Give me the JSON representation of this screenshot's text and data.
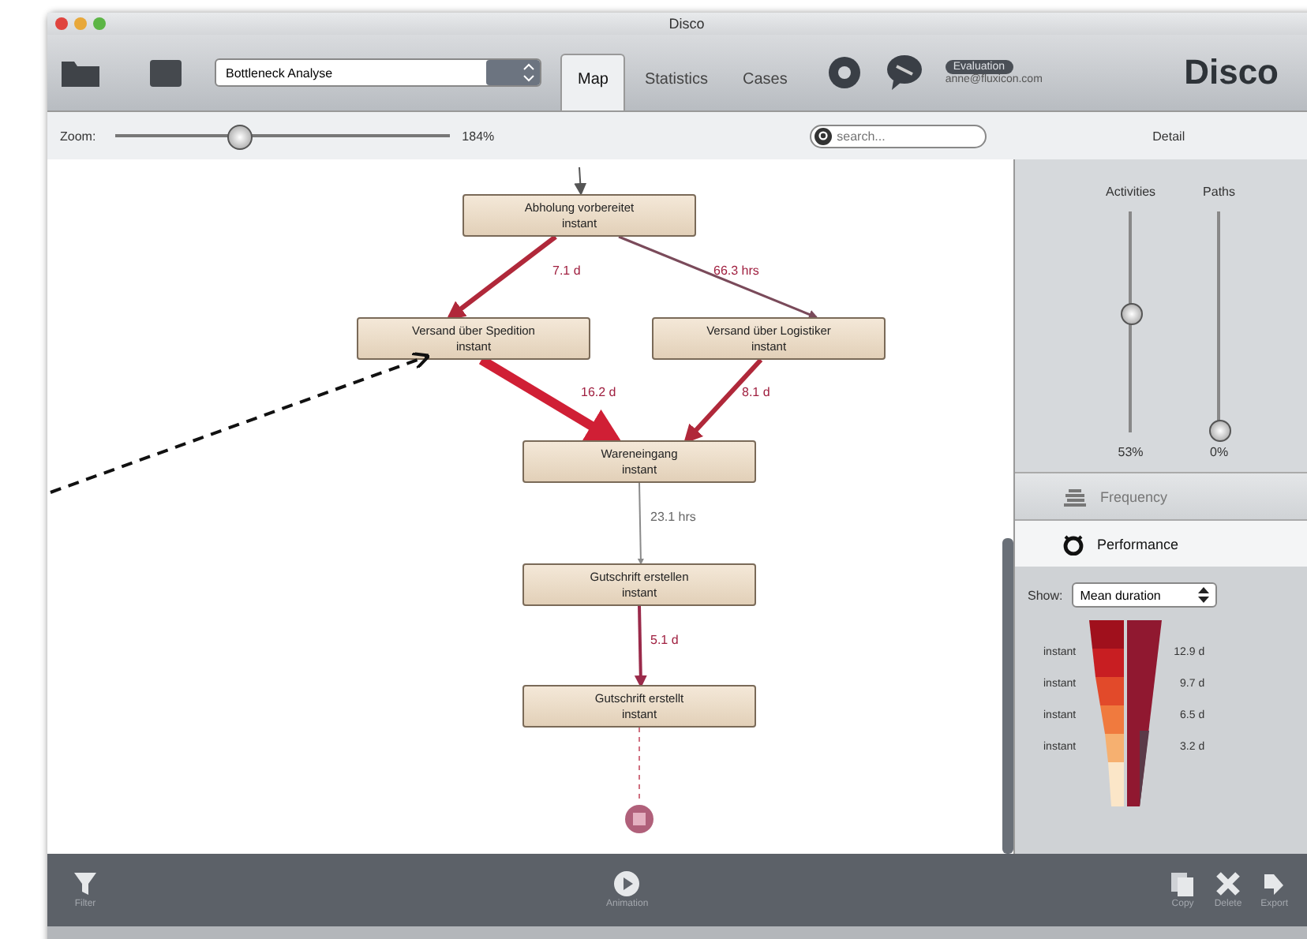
{
  "window": {
    "title": "Disco"
  },
  "toolbar": {
    "log_name": "Bottleneck Analyse",
    "tabs": [
      {
        "label": "Map",
        "selected": true
      },
      {
        "label": "Statistics",
        "selected": false
      },
      {
        "label": "Cases",
        "selected": false
      }
    ],
    "license_badge": "Evaluation",
    "user_email": "anne@fluxicon.com",
    "logo": "Disco"
  },
  "zoom": {
    "label": "Zoom:",
    "level": 0.37,
    "reading": "184%"
  },
  "search": {
    "placeholder": "search..."
  },
  "map": {
    "nodes": [
      {
        "name": "Abholung vorbereitet",
        "value": "instant"
      },
      {
        "name": "Versand über Spedition",
        "value": "instant"
      },
      {
        "name": "Versand über Logistiker",
        "value": "instant"
      },
      {
        "name": "Wareneingang",
        "value": "instant"
      },
      {
        "name": "Gutschrift erstellen",
        "value": "instant"
      },
      {
        "name": "Gutschrift erstellt",
        "value": "instant"
      }
    ],
    "edges": [
      {
        "label": "7.1 d",
        "color": "#b0283a"
      },
      {
        "label": "66.3 hrs",
        "color": "#7a4a5a"
      },
      {
        "label": "16.2 d",
        "color": "#d01f35"
      },
      {
        "label": "8.1 d",
        "color": "#b0283a"
      },
      {
        "label": "23.1 hrs",
        "color": "#8a8a8a"
      },
      {
        "label": "5.1 d",
        "color": "#9a2a4a"
      }
    ]
  },
  "detail": {
    "title": "Detail",
    "sliders": [
      {
        "label": "Activities",
        "level": 0.53,
        "reading": "53%"
      },
      {
        "label": "Paths",
        "level": 0,
        "reading": "0%"
      }
    ],
    "modes": [
      {
        "label": "Frequency",
        "selected": false
      },
      {
        "label": "Performance",
        "selected": true
      }
    ],
    "show_label": "Show:",
    "show_value": "Mean duration",
    "legend_left": [
      "instant",
      "instant",
      "instant",
      "instant"
    ],
    "legend_right": [
      "12.9 d",
      "9.7 d",
      "6.5 d",
      "3.2 d"
    ]
  },
  "bottom_bar": {
    "left": "Filter",
    "center": "Animation",
    "right": [
      "Copy",
      "Delete",
      "Export"
    ]
  }
}
